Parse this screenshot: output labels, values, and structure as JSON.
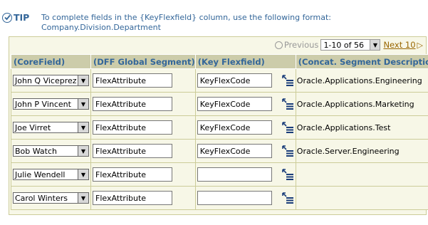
{
  "tip": {
    "label": "TIP",
    "line1": "To complete fields in the {KeyFlexfield} column, use the following format:",
    "line2": "Company.Division.Department"
  },
  "nav": {
    "previous": "Previous",
    "range": "1-10 of 56",
    "next": "Next 10"
  },
  "columns": [
    "(CoreField)",
    "(DFF Global Segment)",
    "(Key Flexfield)",
    "(Concat. Segment Descriptions)"
  ],
  "rows": [
    {
      "core": "John Q Viceprez",
      "dff": "FlexAttribute",
      "key": "KeyFlexCode",
      "concat": "Oracle.Applications.Engineering"
    },
    {
      "core": "John P Vincent",
      "dff": "FlexAttribute",
      "key": "KeyFlexCode",
      "concat": "Oracle.Applications.Marketing"
    },
    {
      "core": "Joe Virret",
      "dff": "FlexAttribute",
      "key": "KeyFlexCode",
      "concat": "Oracle.Applications.Test"
    },
    {
      "core": "Bob Watch",
      "dff": "FlexAttribute",
      "key": "KeyFlexCode",
      "concat": "Oracle.Server.Engineering"
    },
    {
      "core": "Julie Wendell",
      "dff": "FlexAttribute",
      "key": "",
      "concat": ""
    },
    {
      "core": "Carol Winters",
      "dff": "FlexAttribute",
      "key": "",
      "concat": ""
    }
  ]
}
